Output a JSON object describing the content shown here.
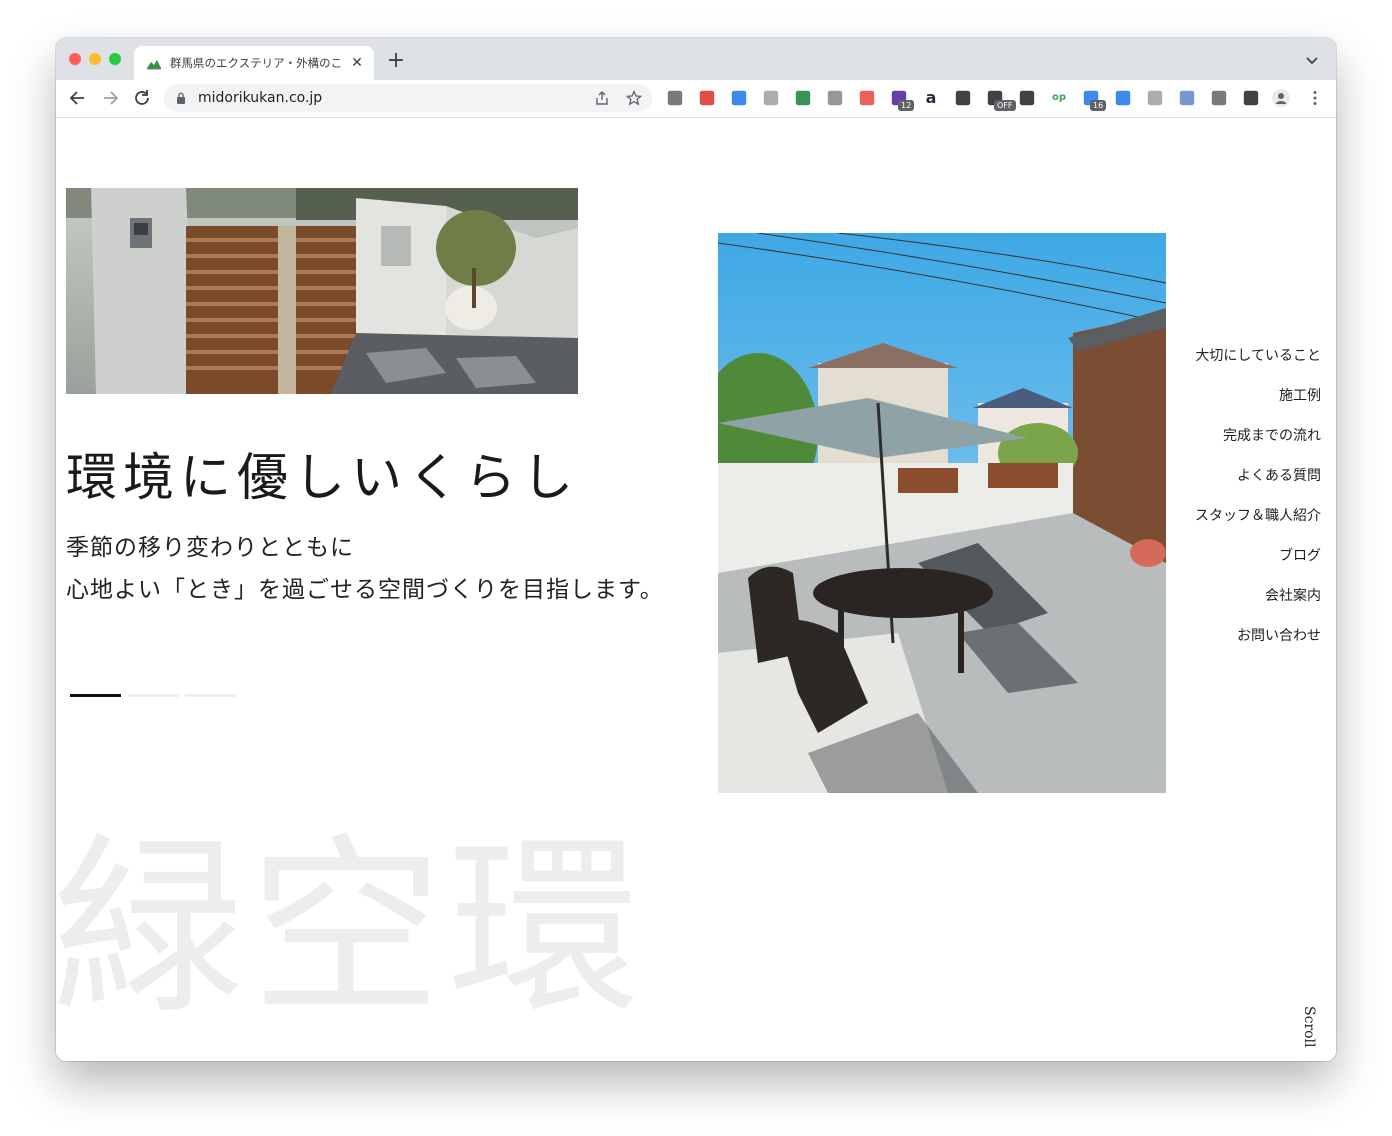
{
  "browser": {
    "tab_title": "群馬県のエクステリア・外構のこと",
    "tab_close": "✕",
    "new_tab": "+",
    "url": "midorikukan.co.jp",
    "extensions": [
      {
        "name": "recycle-ext-icon",
        "color": "#5f6368"
      },
      {
        "name": "screenshot-ext-icon",
        "color": "#d93025"
      },
      {
        "name": "tab-ext-icon",
        "color": "#1a73e8"
      },
      {
        "name": "code-ext-icon",
        "color": "#9aa0a6"
      },
      {
        "name": "robot-ext-icon",
        "color": "#188038"
      },
      {
        "name": "camera-ext-icon",
        "color": "#80868b"
      },
      {
        "name": "color-wheel-ext-icon",
        "color": "#e8453c"
      },
      {
        "name": "graduation-cap-ext-icon",
        "color": "#4a1d96",
        "badge": "12"
      },
      {
        "name": "amazon-ext-icon",
        "color": "#232f3e",
        "glyph": "a"
      },
      {
        "name": "qr-code-ext-icon",
        "color": "#202124"
      },
      {
        "name": "speedometer-ext-icon",
        "color": "#202124",
        "badge": "OFF"
      },
      {
        "name": "wordpress-ext-icon",
        "color": "#202124"
      },
      {
        "name": "op-ext-icon",
        "color": "#34a853",
        "glyph": "op"
      },
      {
        "name": "gear-ext-icon",
        "color": "#1a73e8",
        "badge": "16"
      },
      {
        "name": "history-ext-icon",
        "color": "#1a73e8"
      },
      {
        "name": "vue-ext-icon",
        "color": "#9aa0a6"
      },
      {
        "name": "link-ext-icon",
        "color": "#5f86c4"
      },
      {
        "name": "puzzle-icon",
        "color": "#5f6368"
      },
      {
        "name": "sidepanel-icon",
        "color": "#202124"
      }
    ]
  },
  "hero": {
    "headline": "環境に優しいくらし",
    "subline_1": "季節の移り変わりとともに",
    "subline_2": "心地よい「とき」を過ごせる空間づくりを目指します。",
    "watermark": "緑空環",
    "slides_total": 3,
    "slide_active": 1
  },
  "nav": {
    "items": [
      "大切にしていること",
      "施工例",
      "完成までの流れ",
      "よくある質問",
      "スタッフ＆職人紹介",
      "ブログ",
      "会社案内",
      "お問い合わせ"
    ]
  },
  "scroll_label": "Scroll"
}
